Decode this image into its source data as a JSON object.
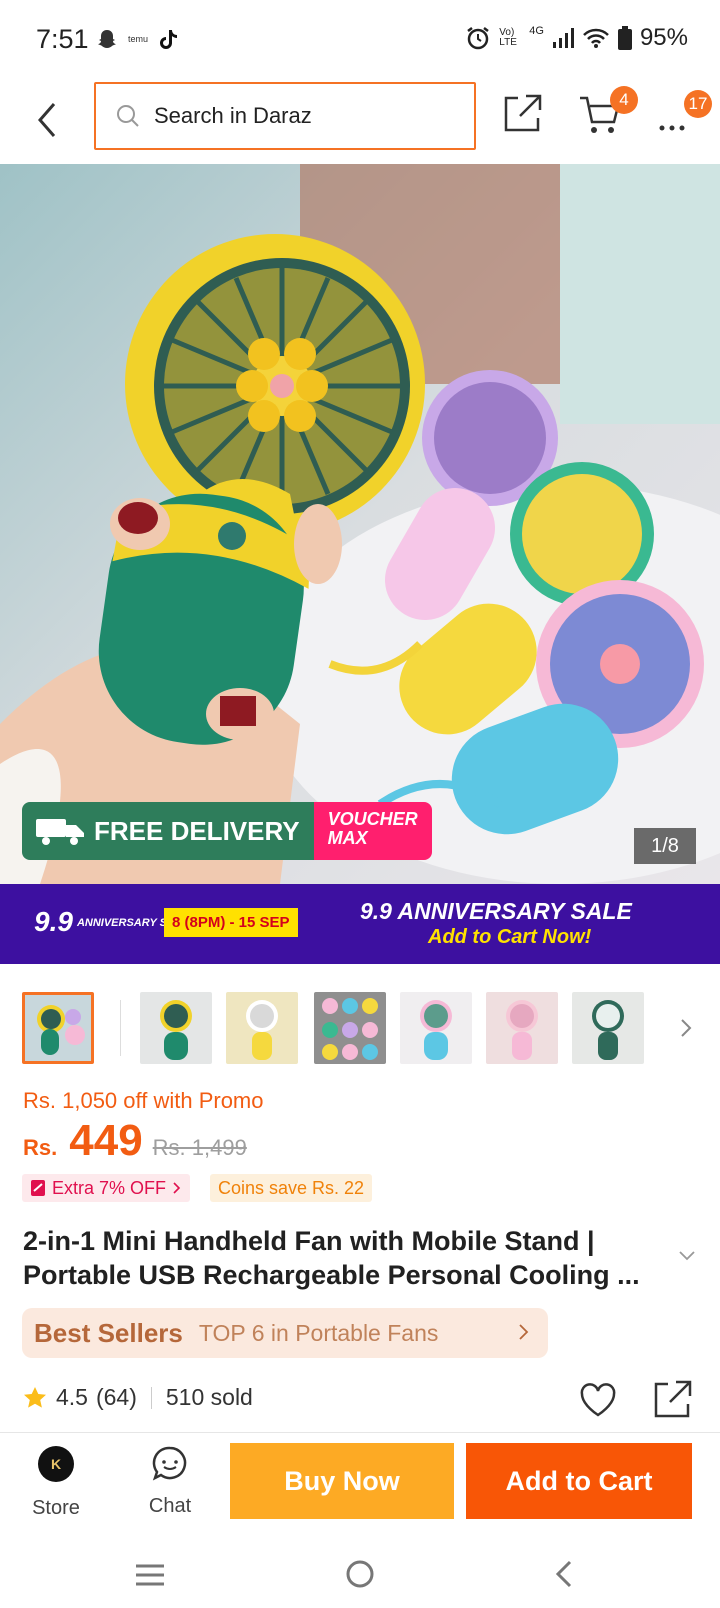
{
  "status_bar": {
    "time": "7:51",
    "icons": [
      "snapchat-icon",
      "temu-icon",
      "tiktok-icon"
    ],
    "right_icons": [
      "alarm-icon",
      "volte-icon",
      "signal-icon",
      "wifi-icon",
      "battery-icon"
    ],
    "network_label": "Vo) LTE",
    "network_gen": "4G",
    "battery": "95%"
  },
  "header": {
    "search_placeholder": "Search in Daraz",
    "cart_badge": "4",
    "more_badge": "17"
  },
  "hero": {
    "free_delivery_label": "FREE DELIVERY",
    "free_truck_label": "FREE",
    "voucher_line1": "VOUCHER",
    "voucher_line2": "MAX",
    "image_counter": "1/8"
  },
  "banner": {
    "logo": "9.9",
    "logo_sub": "ANNIVERSARY SALE",
    "dates": "8 (8PM) - 15 SEP",
    "headline": "9.9 ANNIVERSARY SALE",
    "subline": "Add to Cart Now!"
  },
  "thumbnails": {
    "count": 7,
    "selected_index": 0
  },
  "pricing": {
    "promo_text": "Rs. 1,050 off with Promo",
    "currency": "Rs.",
    "price": "449",
    "original_price": "Rs. 1,499",
    "extra_off": "Extra 7% OFF",
    "coins_save": "Coins save Rs. 22"
  },
  "product": {
    "title_line1": "2-in-1 Mini Handheld Fan with Mobile Stand |",
    "title_line2": "Portable USB Rechargeable Personal Cooling ...",
    "best_seller_label": "Best Sellers",
    "best_seller_rank": "TOP 6 in Portable Fans",
    "rating": "4.5",
    "rating_count": "(64)",
    "sold": "510 sold"
  },
  "bottom_bar": {
    "store_label": "Store",
    "chat_label": "Chat",
    "buy_now": "Buy Now",
    "add_to_cart": "Add to Cart"
  },
  "colors": {
    "accent": "#f57224",
    "buy_now": "#fdaa24",
    "add_to_cart": "#f85606",
    "banner_bg": "#3d10a0"
  }
}
